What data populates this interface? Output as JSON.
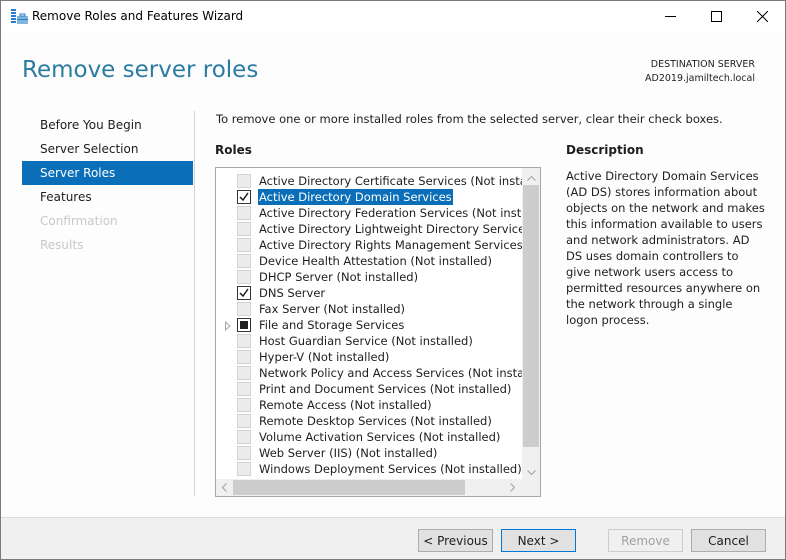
{
  "window": {
    "title": "Remove Roles and Features Wizard",
    "app_icon": "server-manager-icon",
    "controls": [
      "minimize-icon",
      "maximize-icon",
      "close-icon"
    ]
  },
  "header": {
    "title": "Remove server roles",
    "destination_label": "DESTINATION SERVER",
    "destination_server": "AD2019.jamiltech.local"
  },
  "nav": {
    "items": [
      {
        "label": "Before You Begin",
        "state": "normal"
      },
      {
        "label": "Server Selection",
        "state": "normal"
      },
      {
        "label": "Server Roles",
        "state": "active"
      },
      {
        "label": "Features",
        "state": "normal"
      },
      {
        "label": "Confirmation",
        "state": "disabled"
      },
      {
        "label": "Results",
        "state": "disabled"
      }
    ]
  },
  "main": {
    "instruction": "To remove one or more installed roles from the selected server, clear their check boxes.",
    "roles_label": "Roles",
    "description_label": "Description",
    "description_text": "Active Directory Domain Services (AD DS) stores information about objects on the network and makes this information available to users and network administrators. AD DS uses domain controllers to give network users access to permitted resources anywhere on the network through a single logon process.",
    "roles": [
      {
        "label": "Active Directory Certificate Services (Not installed)",
        "state": "unchecked",
        "expandable": false,
        "selected": false
      },
      {
        "label": "Active Directory Domain Services",
        "state": "checked",
        "expandable": false,
        "selected": true
      },
      {
        "label": "Active Directory Federation Services (Not installed)",
        "state": "unchecked",
        "expandable": false,
        "selected": false
      },
      {
        "label": "Active Directory Lightweight Directory Services (Not installed)",
        "state": "unchecked",
        "expandable": false,
        "selected": false
      },
      {
        "label": "Active Directory Rights Management Services (Not installed)",
        "state": "unchecked",
        "expandable": false,
        "selected": false
      },
      {
        "label": "Device Health Attestation (Not installed)",
        "state": "unchecked",
        "expandable": false,
        "selected": false
      },
      {
        "label": "DHCP Server (Not installed)",
        "state": "unchecked",
        "expandable": false,
        "selected": false
      },
      {
        "label": "DNS Server",
        "state": "checked",
        "expandable": false,
        "selected": false
      },
      {
        "label": "Fax Server (Not installed)",
        "state": "unchecked",
        "expandable": false,
        "selected": false
      },
      {
        "label": "File and Storage Services",
        "state": "partial",
        "expandable": true,
        "selected": false
      },
      {
        "label": "Host Guardian Service (Not installed)",
        "state": "unchecked",
        "expandable": false,
        "selected": false
      },
      {
        "label": "Hyper-V (Not installed)",
        "state": "unchecked",
        "expandable": false,
        "selected": false
      },
      {
        "label": "Network Policy and Access Services (Not installed)",
        "state": "unchecked",
        "expandable": false,
        "selected": false
      },
      {
        "label": "Print and Document Services (Not installed)",
        "state": "unchecked",
        "expandable": false,
        "selected": false
      },
      {
        "label": "Remote Access (Not installed)",
        "state": "unchecked",
        "expandable": false,
        "selected": false
      },
      {
        "label": "Remote Desktop Services (Not installed)",
        "state": "unchecked",
        "expandable": false,
        "selected": false
      },
      {
        "label": "Volume Activation Services (Not installed)",
        "state": "unchecked",
        "expandable": false,
        "selected": false
      },
      {
        "label": "Web Server (IIS) (Not installed)",
        "state": "unchecked",
        "expandable": false,
        "selected": false
      },
      {
        "label": "Windows Deployment Services (Not installed)",
        "state": "unchecked",
        "expandable": false,
        "selected": false
      }
    ]
  },
  "footer": {
    "previous_label": "< Previous",
    "next_label": "Next >",
    "remove_label": "Remove",
    "cancel_label": "Cancel"
  },
  "colors": {
    "accent": "#0a6fb8",
    "title": "#2b7ca1",
    "disabled_text": "#c8c8c8"
  }
}
